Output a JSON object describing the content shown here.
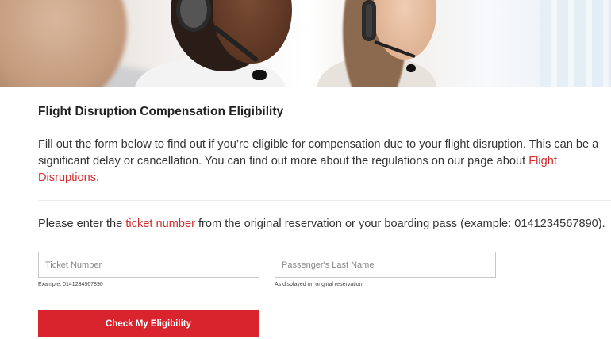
{
  "hero": {
    "image": "customer-service-agents-headsets"
  },
  "page": {
    "title": "Flight Disruption Compensation Eligibility",
    "intro_text": "Fill out the form below to find out if you’re eligible for compensation due to your flight disruption. This can be a significant delay or cancellation. You can find out more about the regulations on our page about ",
    "intro_link": "Flight Disruptions",
    "intro_end": ".",
    "instruction_prefix": "Please enter the ",
    "instruction_link": "ticket number",
    "instruction_suffix": " from the original reservation or your boarding pass (example: 0141234567890)."
  },
  "form": {
    "ticket": {
      "value": "",
      "placeholder": "Ticket Number",
      "hint": "Example: 0141234567890"
    },
    "last_name": {
      "value": "",
      "placeholder": "Passenger's Last Name",
      "hint": "As displayed on original reservation"
    },
    "submit_label": "Check My Eligibility"
  },
  "colors": {
    "accent": "#d9232d",
    "link": "#d52b2b"
  }
}
